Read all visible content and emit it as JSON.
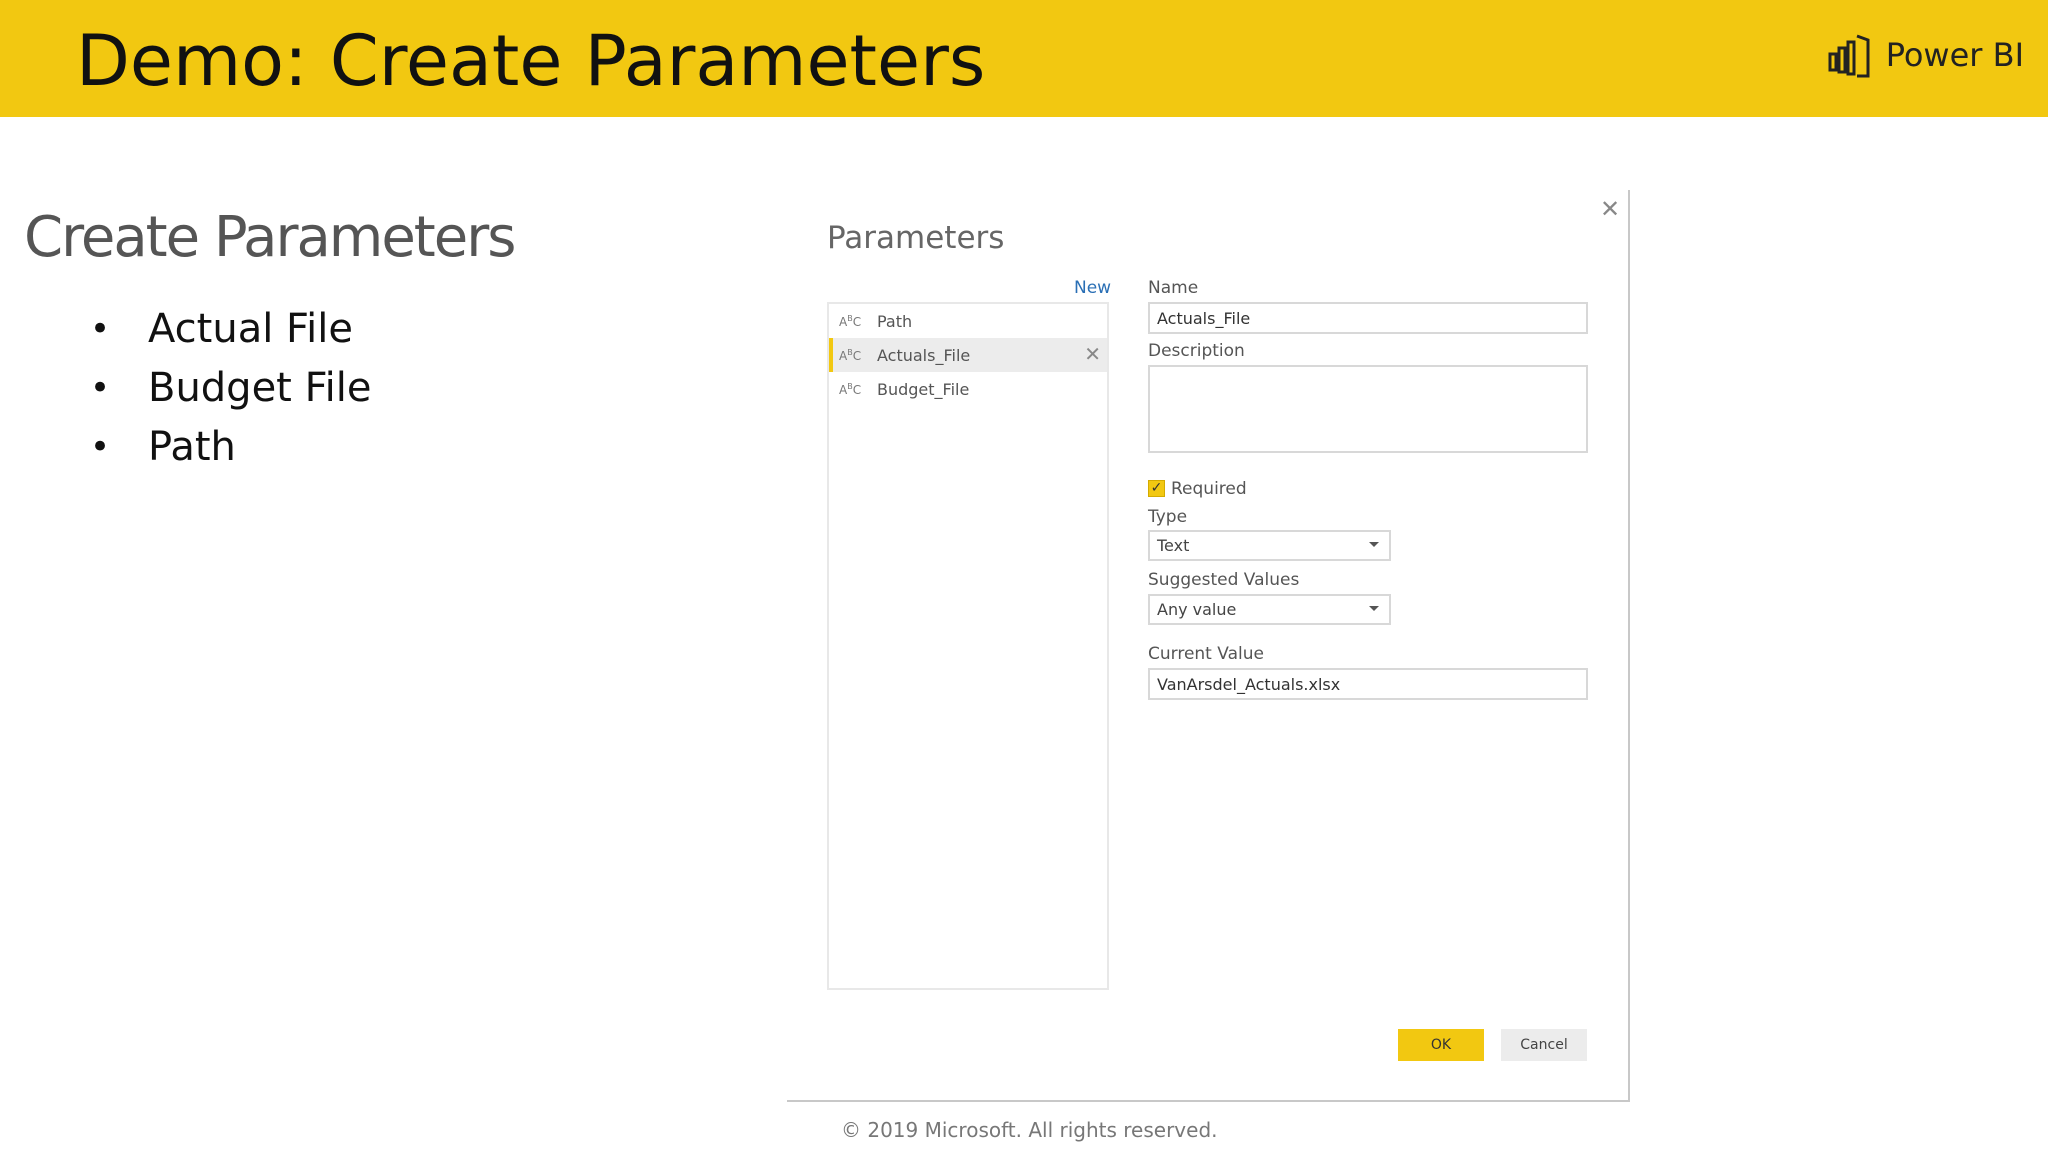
{
  "slide": {
    "title": "Demo: Create Parameters",
    "brand": "Power BI",
    "brand_icon": "power-bi-logo-icon",
    "accent_color": "#f2c811"
  },
  "content": {
    "heading": "Create Parameters",
    "bullets": [
      "Actual File",
      "Budget File",
      "Path"
    ]
  },
  "dialog": {
    "title": "Parameters",
    "close_icon": "close-icon",
    "new_label": "New",
    "items": [
      {
        "label": "Path",
        "type_icon": "text-type-icon"
      },
      {
        "label": "Actuals_File",
        "type_icon": "text-type-icon",
        "selected": true
      },
      {
        "label": "Budget_File",
        "type_icon": "text-type-icon"
      }
    ],
    "name_label": "Name",
    "name_value": "Actuals_File",
    "description_label": "Description",
    "description_value": "",
    "required_label": "Required",
    "required_checked": true,
    "type_label": "Type",
    "type_value": "Text",
    "suggested_label": "Suggested Values",
    "suggested_value": "Any value",
    "current_label": "Current Value",
    "current_value": "VanArsdel_Actuals.xlsx",
    "ok_label": "OK",
    "cancel_label": "Cancel"
  },
  "footer": {
    "copyright": "© 2019 Microsoft. All rights reserved."
  }
}
